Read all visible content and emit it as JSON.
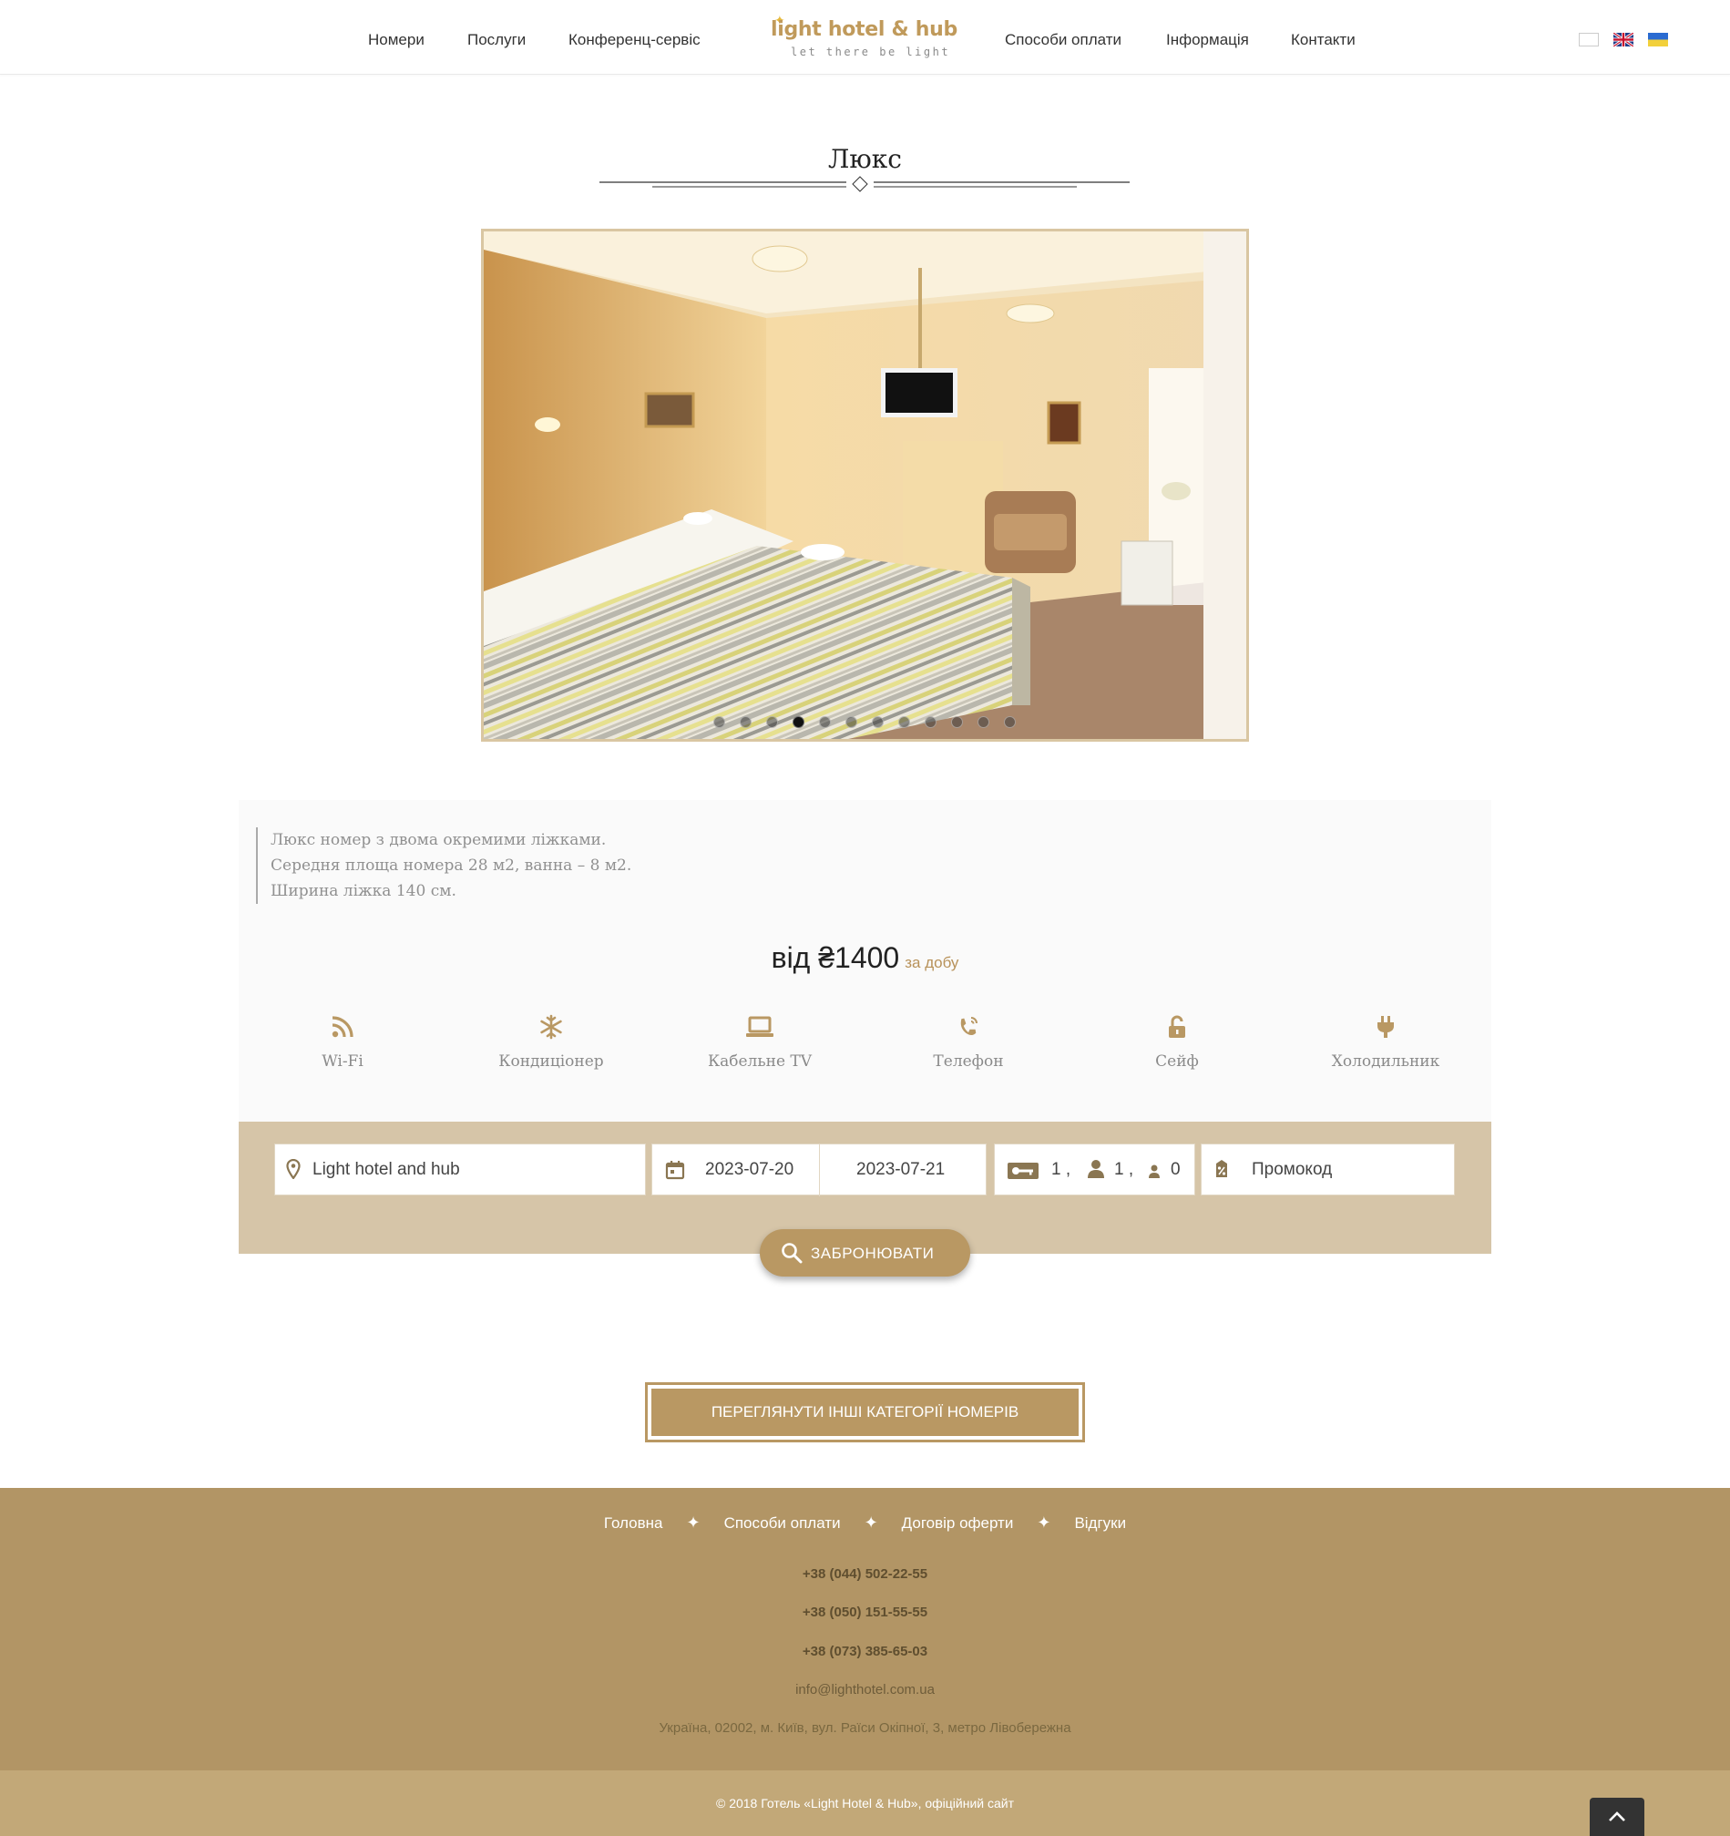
{
  "header": {
    "nav_left": [
      "Номери",
      "Послуги",
      "Конференц-сервіс"
    ],
    "nav_right": [
      "Способи оплати",
      "Інформація",
      "Контакти"
    ],
    "logo_title": "light hotel & hub",
    "logo_tagline": "let there be light",
    "languages": [
      "blank-flag-icon",
      "uk-flag-icon",
      "ua-flag-icon"
    ]
  },
  "room": {
    "title": "Люкс",
    "slider": {
      "slide_count": 12,
      "active_slide": 4
    },
    "description": [
      "Люкс номер з двома окремими ліжками.",
      "Середня площа номера 28 м2, ванна – 8 м2.",
      "Ширина ліжка 140 см."
    ],
    "price_prefix": "від",
    "price": "₴1400",
    "price_period": "за добу",
    "amenities": [
      {
        "icon": "wifi-icon",
        "label": "Wi-Fi"
      },
      {
        "icon": "snowflake-icon",
        "label": "Кондиціонер"
      },
      {
        "icon": "laptop-icon",
        "label": "Кабельне TV"
      },
      {
        "icon": "phone-icon",
        "label": "Телефон"
      },
      {
        "icon": "unlock-icon",
        "label": "Сейф"
      },
      {
        "icon": "plug-icon",
        "label": "Холодильник"
      }
    ]
  },
  "booking": {
    "hotel": "Light hotel and hub",
    "checkin": "2023-07-20",
    "checkout": "2023-07-21",
    "rooms": "1 ,",
    "adults": "1 ,",
    "children": "0",
    "promo_placeholder": "Промокод",
    "submit_label": "ЗАБРОНЮВАТИ"
  },
  "more_button": "ПЕРЕГЛЯНУТИ ІНШІ КАТЕГОРІЇ НОМЕРІВ",
  "footer": {
    "links": [
      "Головна",
      "Способи оплати",
      "Договір оферти",
      "Відгуки"
    ],
    "separator": "✦",
    "phones": [
      "+38 (044) 502-22-55",
      "+38 (050) 151-55-55",
      "+38 (073) 385-65-03"
    ],
    "email": "info@lighthotel.com.ua",
    "address": "Україна, 02002, м. Київ, вул. Раїси Окіпної, 3, метро Лівобережна",
    "copyright": "© 2018 Готель «Light Hotel & Hub», офіційний сайт"
  },
  "colors": {
    "accent": "#b99863",
    "footer": "#b29565",
    "booking_bg": "#d6c5a8",
    "bottom_bar": "#c2a878"
  }
}
